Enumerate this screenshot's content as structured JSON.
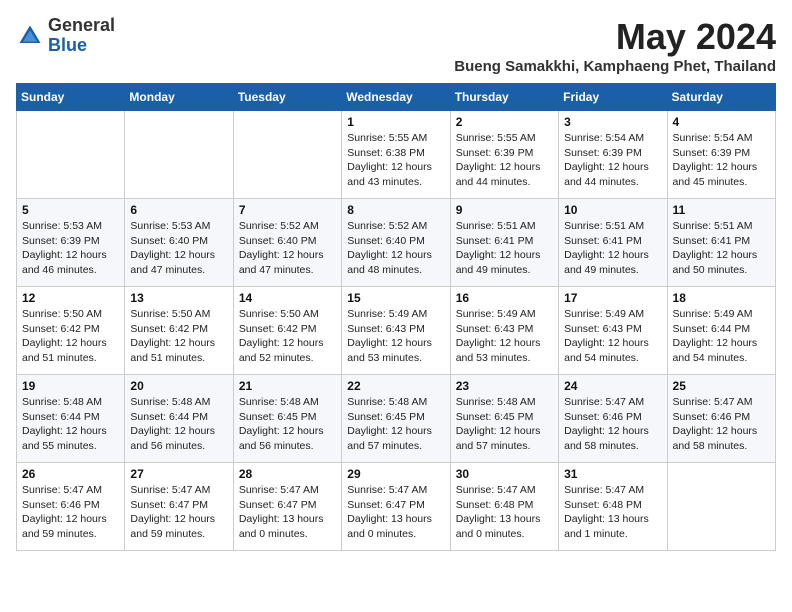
{
  "header": {
    "logo_general": "General",
    "logo_blue": "Blue",
    "month_title": "May 2024",
    "location": "Bueng Samakkhi, Kamphaeng Phet, Thailand"
  },
  "days_of_week": [
    "Sunday",
    "Monday",
    "Tuesday",
    "Wednesday",
    "Thursday",
    "Friday",
    "Saturday"
  ],
  "weeks": [
    [
      {
        "day": "",
        "info": ""
      },
      {
        "day": "",
        "info": ""
      },
      {
        "day": "",
        "info": ""
      },
      {
        "day": "1",
        "info": "Sunrise: 5:55 AM\nSunset: 6:38 PM\nDaylight: 12 hours\nand 43 minutes."
      },
      {
        "day": "2",
        "info": "Sunrise: 5:55 AM\nSunset: 6:39 PM\nDaylight: 12 hours\nand 44 minutes."
      },
      {
        "day": "3",
        "info": "Sunrise: 5:54 AM\nSunset: 6:39 PM\nDaylight: 12 hours\nand 44 minutes."
      },
      {
        "day": "4",
        "info": "Sunrise: 5:54 AM\nSunset: 6:39 PM\nDaylight: 12 hours\nand 45 minutes."
      }
    ],
    [
      {
        "day": "5",
        "info": "Sunrise: 5:53 AM\nSunset: 6:39 PM\nDaylight: 12 hours\nand 46 minutes."
      },
      {
        "day": "6",
        "info": "Sunrise: 5:53 AM\nSunset: 6:40 PM\nDaylight: 12 hours\nand 47 minutes."
      },
      {
        "day": "7",
        "info": "Sunrise: 5:52 AM\nSunset: 6:40 PM\nDaylight: 12 hours\nand 47 minutes."
      },
      {
        "day": "8",
        "info": "Sunrise: 5:52 AM\nSunset: 6:40 PM\nDaylight: 12 hours\nand 48 minutes."
      },
      {
        "day": "9",
        "info": "Sunrise: 5:51 AM\nSunset: 6:41 PM\nDaylight: 12 hours\nand 49 minutes."
      },
      {
        "day": "10",
        "info": "Sunrise: 5:51 AM\nSunset: 6:41 PM\nDaylight: 12 hours\nand 49 minutes."
      },
      {
        "day": "11",
        "info": "Sunrise: 5:51 AM\nSunset: 6:41 PM\nDaylight: 12 hours\nand 50 minutes."
      }
    ],
    [
      {
        "day": "12",
        "info": "Sunrise: 5:50 AM\nSunset: 6:42 PM\nDaylight: 12 hours\nand 51 minutes."
      },
      {
        "day": "13",
        "info": "Sunrise: 5:50 AM\nSunset: 6:42 PM\nDaylight: 12 hours\nand 51 minutes."
      },
      {
        "day": "14",
        "info": "Sunrise: 5:50 AM\nSunset: 6:42 PM\nDaylight: 12 hours\nand 52 minutes."
      },
      {
        "day": "15",
        "info": "Sunrise: 5:49 AM\nSunset: 6:43 PM\nDaylight: 12 hours\nand 53 minutes."
      },
      {
        "day": "16",
        "info": "Sunrise: 5:49 AM\nSunset: 6:43 PM\nDaylight: 12 hours\nand 53 minutes."
      },
      {
        "day": "17",
        "info": "Sunrise: 5:49 AM\nSunset: 6:43 PM\nDaylight: 12 hours\nand 54 minutes."
      },
      {
        "day": "18",
        "info": "Sunrise: 5:49 AM\nSunset: 6:44 PM\nDaylight: 12 hours\nand 54 minutes."
      }
    ],
    [
      {
        "day": "19",
        "info": "Sunrise: 5:48 AM\nSunset: 6:44 PM\nDaylight: 12 hours\nand 55 minutes."
      },
      {
        "day": "20",
        "info": "Sunrise: 5:48 AM\nSunset: 6:44 PM\nDaylight: 12 hours\nand 56 minutes."
      },
      {
        "day": "21",
        "info": "Sunrise: 5:48 AM\nSunset: 6:45 PM\nDaylight: 12 hours\nand 56 minutes."
      },
      {
        "day": "22",
        "info": "Sunrise: 5:48 AM\nSunset: 6:45 PM\nDaylight: 12 hours\nand 57 minutes."
      },
      {
        "day": "23",
        "info": "Sunrise: 5:48 AM\nSunset: 6:45 PM\nDaylight: 12 hours\nand 57 minutes."
      },
      {
        "day": "24",
        "info": "Sunrise: 5:47 AM\nSunset: 6:46 PM\nDaylight: 12 hours\nand 58 minutes."
      },
      {
        "day": "25",
        "info": "Sunrise: 5:47 AM\nSunset: 6:46 PM\nDaylight: 12 hours\nand 58 minutes."
      }
    ],
    [
      {
        "day": "26",
        "info": "Sunrise: 5:47 AM\nSunset: 6:46 PM\nDaylight: 12 hours\nand 59 minutes."
      },
      {
        "day": "27",
        "info": "Sunrise: 5:47 AM\nSunset: 6:47 PM\nDaylight: 12 hours\nand 59 minutes."
      },
      {
        "day": "28",
        "info": "Sunrise: 5:47 AM\nSunset: 6:47 PM\nDaylight: 13 hours\nand 0 minutes."
      },
      {
        "day": "29",
        "info": "Sunrise: 5:47 AM\nSunset: 6:47 PM\nDaylight: 13 hours\nand 0 minutes."
      },
      {
        "day": "30",
        "info": "Sunrise: 5:47 AM\nSunset: 6:48 PM\nDaylight: 13 hours\nand 0 minutes."
      },
      {
        "day": "31",
        "info": "Sunrise: 5:47 AM\nSunset: 6:48 PM\nDaylight: 13 hours\nand 1 minute."
      },
      {
        "day": "",
        "info": ""
      }
    ]
  ]
}
